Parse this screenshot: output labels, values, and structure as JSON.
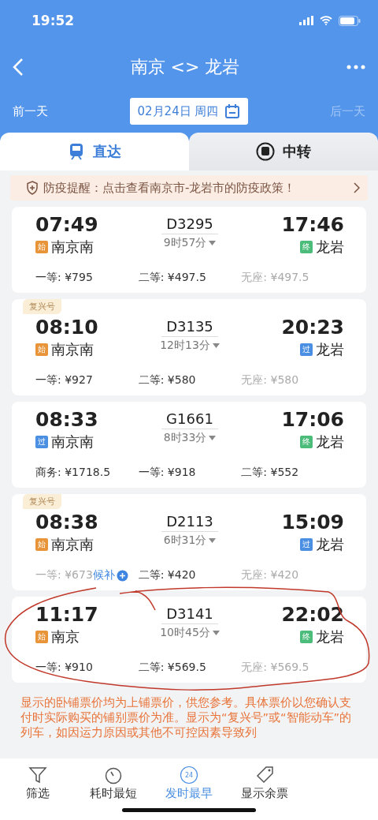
{
  "status_bar": {
    "time": "19:52"
  },
  "header": {
    "title": "南京 <> 龙岩"
  },
  "date_bar": {
    "prev": "前一天",
    "date": "02月24日 周四",
    "next": "后一天",
    "next_disabled": true
  },
  "tabs": [
    {
      "label": "直达",
      "selected": true,
      "kind": "direct"
    },
    {
      "label": "中转",
      "selected": false,
      "kind": "transfer"
    }
  ],
  "notice_banner": "防疫提醒：点击查看南京市-龙岩市的防疫政策！",
  "trains": [
    {
      "depart_time": "07:49",
      "from": {
        "tag": "始",
        "color": "#e8953a",
        "station": "南京南"
      },
      "number": "D3295",
      "duration": "9时57分",
      "arrive_time": "17:46",
      "to": {
        "tag": "终",
        "color": "#4cbc7a",
        "station": "龙岩"
      },
      "fares": [
        {
          "label": "一等: ¥795",
          "available": true
        },
        {
          "label": "二等: ¥497.5",
          "available": true
        },
        {
          "label": "无座: ¥497.5",
          "available": false
        }
      ]
    },
    {
      "badge": "复兴号",
      "depart_time": "08:10",
      "from": {
        "tag": "始",
        "color": "#e8953a",
        "station": "南京南"
      },
      "number": "D3135",
      "duration": "12时13分",
      "arrive_time": "20:23",
      "to": {
        "tag": "过",
        "color": "#4a8fe2",
        "station": "龙岩"
      },
      "fares": [
        {
          "label": "一等: ¥927",
          "available": true
        },
        {
          "label": "二等: ¥580",
          "available": true
        },
        {
          "label": "无座: ¥580",
          "available": false
        }
      ]
    },
    {
      "depart_time": "08:33",
      "from": {
        "tag": "过",
        "color": "#4a8fe2",
        "station": "南京南"
      },
      "number": "G1661",
      "duration": "8时33分",
      "arrive_time": "17:06",
      "to": {
        "tag": "终",
        "color": "#4cbc7a",
        "station": "龙岩"
      },
      "fares": [
        {
          "label": "商务: ¥1718.5",
          "available": true
        },
        {
          "label": "一等: ¥918",
          "available": true
        },
        {
          "label": "二等: ¥552",
          "available": true
        }
      ]
    },
    {
      "badge": "复兴号",
      "depart_time": "08:38",
      "from": {
        "tag": "始",
        "color": "#e8953a",
        "station": "南京南"
      },
      "number": "D2113",
      "duration": "6时31分",
      "arrive_time": "15:09",
      "to": {
        "tag": "过",
        "color": "#4a8fe2",
        "station": "龙岩"
      },
      "fares": [
        {
          "label": "一等: ¥673",
          "available": false,
          "waitlist": "候补"
        },
        {
          "label": "二等: ¥420",
          "available": true
        },
        {
          "label": "无座: ¥420",
          "available": false
        }
      ]
    },
    {
      "depart_time": "11:17",
      "from": {
        "tag": "始",
        "color": "#e8953a",
        "station": "南京"
      },
      "number": "D3141",
      "duration": "10时45分",
      "arrive_time": "22:02",
      "to": {
        "tag": "终",
        "color": "#4cbc7a",
        "station": "龙岩"
      },
      "fares": [
        {
          "label": "一等: ¥910",
          "available": true
        },
        {
          "label": "二等: ¥569.5",
          "available": true
        },
        {
          "label": "无座: ¥569.5",
          "available": false
        }
      ]
    }
  ],
  "footer_note": "显示的卧铺票价均为上铺票价，供您参考。具体票价以您确认支付时实际购买的铺别票价为准。显示为“复兴号”或“智能动车”的列车，如因运力原因或其他不可控因素导致列",
  "bottom_tabs": [
    {
      "label": "筛选",
      "kind": "filter",
      "selected": false
    },
    {
      "label": "耗时最短",
      "kind": "timer",
      "selected": false
    },
    {
      "label": "发时最早",
      "kind": "clock",
      "selected": true,
      "icon_text": "24"
    },
    {
      "label": "显示余票",
      "kind": "tag",
      "selected": false
    }
  ]
}
